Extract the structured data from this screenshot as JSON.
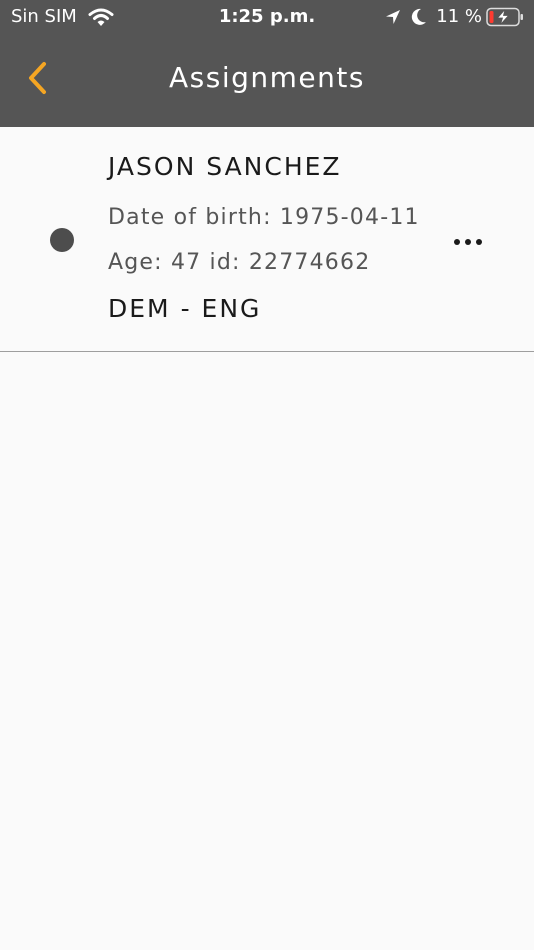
{
  "status_bar": {
    "carrier": "Sin SIM",
    "time": "1:25 p.m.",
    "battery_percent": "11 %"
  },
  "header": {
    "title": "Assignments",
    "back_icon": "chevron-left-icon"
  },
  "colors": {
    "header_bg": "#555555",
    "accent": "#f5a623",
    "page_bg": "#fafafa",
    "battery_low": "#ff3b30"
  },
  "assignments": [
    {
      "name": "JASON SANCHEZ",
      "date_of_birth": "Date of birth: 1975-04-11",
      "age_id": "Age: 47 id: 22774662",
      "languages": "DEM - ENG",
      "status_icon": "status-dot-icon",
      "menu_icon": "more-horizontal-icon"
    }
  ]
}
